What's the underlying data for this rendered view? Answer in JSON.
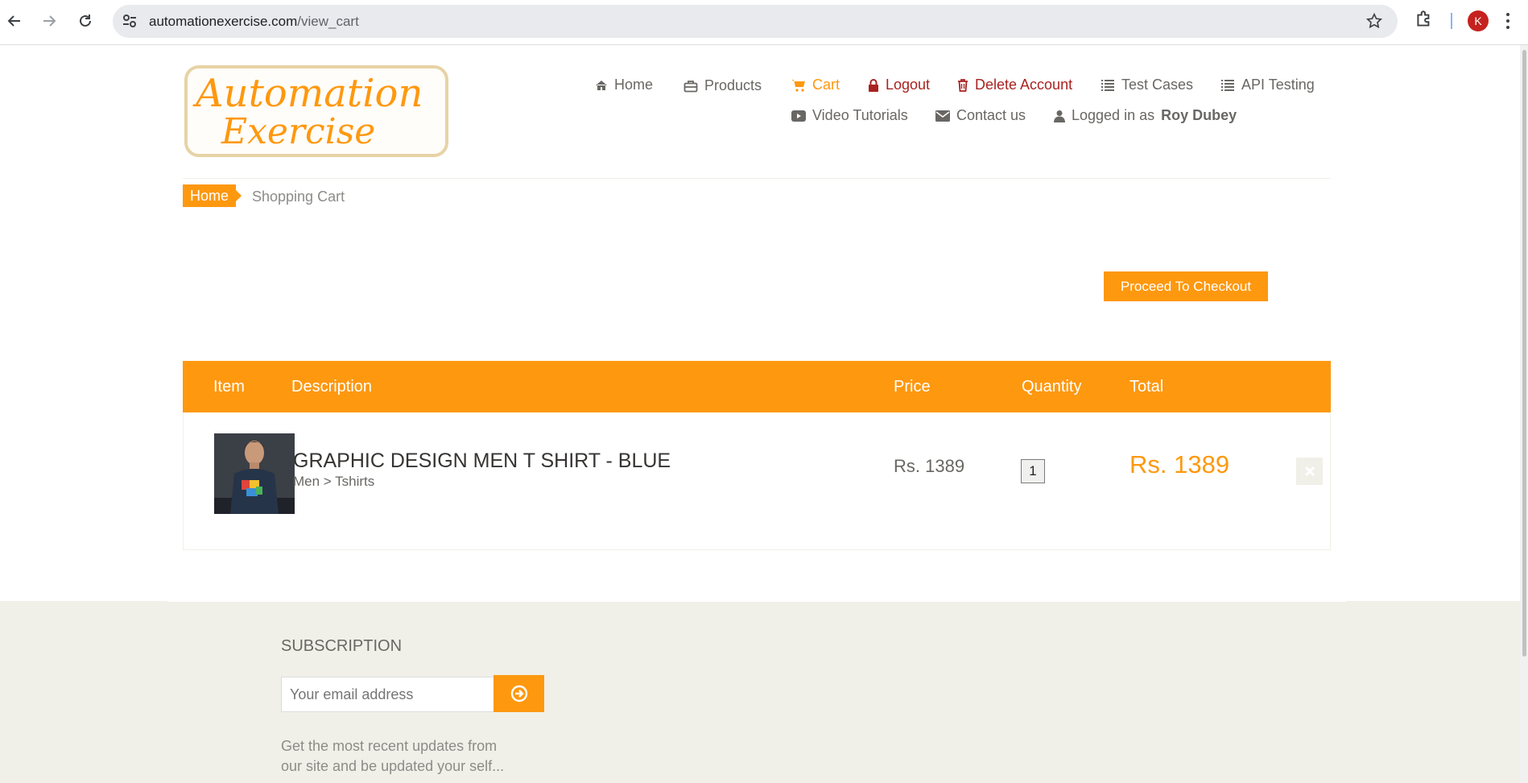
{
  "browser": {
    "url_host": "automationexercise.com",
    "url_path": "/view_cart",
    "avatar_letter": "K",
    "icons": [
      "back-icon",
      "forward-icon",
      "reload-icon",
      "tune-icon",
      "star-icon",
      "extensions-icon",
      "kebab-menu-icon"
    ]
  },
  "logo": {
    "line1": "Automation",
    "line2": "Exercise"
  },
  "nav": {
    "home": "Home",
    "products": "Products",
    "cart": "Cart",
    "logout": "Logout",
    "delete_account": "Delete Account",
    "test_cases": "Test Cases",
    "api_testing": "API Testing",
    "video_tutorials": "Video Tutorials",
    "contact_us": "Contact us",
    "logged_in_prefix": "Logged in as",
    "logged_in_user": "Roy Dubey"
  },
  "breadcrumb": {
    "home": "Home",
    "current": "Shopping Cart"
  },
  "checkout_label": "Proceed To Checkout",
  "cart": {
    "headers": {
      "item": "Item",
      "description": "Description",
      "price": "Price",
      "quantity": "Quantity",
      "total": "Total"
    },
    "items": [
      {
        "name": "GRAPHIC DESIGN MEN T SHIRT - BLUE",
        "category": "Men > Tshirts",
        "price": "Rs. 1389",
        "quantity": "1",
        "total": "Rs. 1389"
      }
    ]
  },
  "footer": {
    "subscription_title": "SUBSCRIPTION",
    "email_placeholder": "Your email address",
    "subscription_text": "Get the most recent updates from our site and be updated your self..."
  },
  "colors": {
    "accent": "#FE980F",
    "danger": "#A92321",
    "footer_bg": "#F0F0E9"
  }
}
